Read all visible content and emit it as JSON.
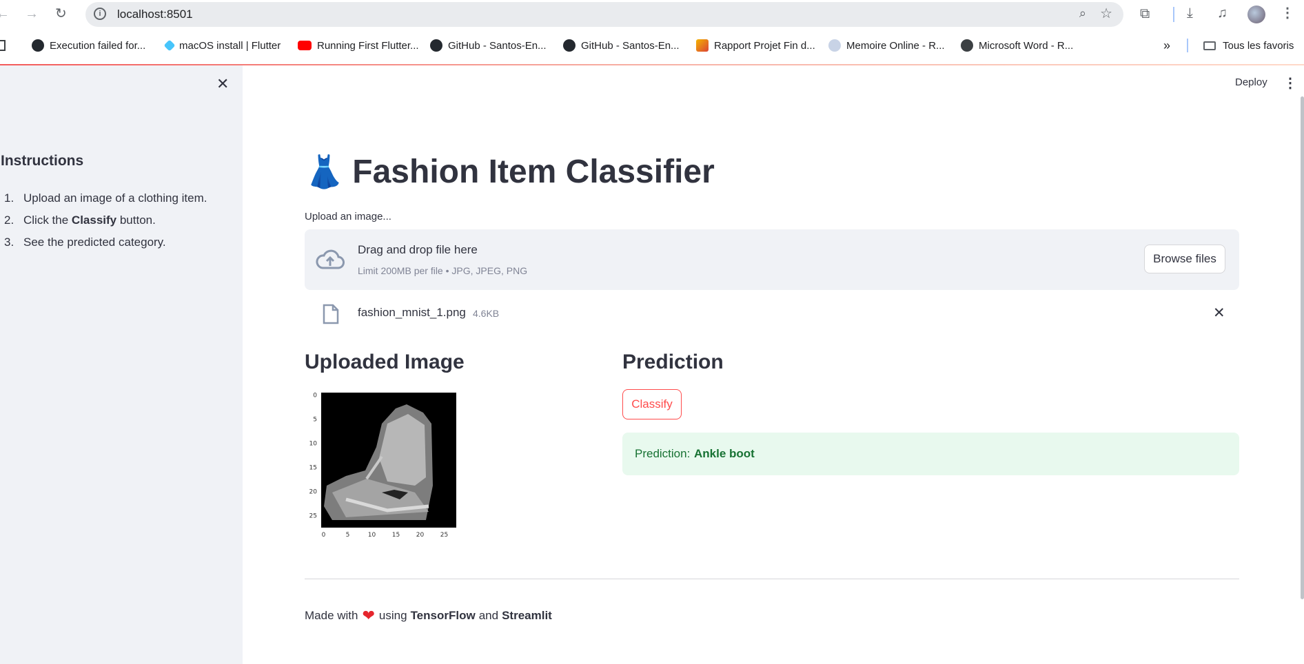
{
  "browser": {
    "url": "localhost:8501",
    "bookmarks": [
      {
        "label": "Execution failed for...",
        "icon": "github-icon"
      },
      {
        "label": "macOS install | Flutter",
        "icon": "flutter-icon"
      },
      {
        "label": "Running First Flutter...",
        "icon": "youtube-icon"
      },
      {
        "label": "GitHub - Santos-En...",
        "icon": "github-icon"
      },
      {
        "label": "GitHub - Santos-En...",
        "icon": "github-icon"
      },
      {
        "label": "Rapport Projet Fin d...",
        "icon": "doc-icon"
      },
      {
        "label": "Memoire Online - R...",
        "icon": "globe-icon"
      },
      {
        "label": "Microsoft Word - R...",
        "icon": "globe-icon"
      }
    ],
    "overflow_label": "»",
    "all_bookmarks": "Tous les favoris"
  },
  "app": {
    "deploy_label": "Deploy",
    "sidebar": {
      "title": "Instructions",
      "steps": [
        {
          "num": "1.",
          "text": "Upload an image of a clothing item."
        },
        {
          "num": "2.",
          "pre": "Click the ",
          "bold": "Classify",
          "post": " button."
        },
        {
          "num": "3.",
          "text": "See the predicted category."
        }
      ]
    },
    "title_emoji": "👗",
    "title": "Fashion Item Classifier",
    "uploader": {
      "label": "Upload an image...",
      "drag_text": "Drag and drop file here",
      "limit_text": "Limit 200MB per file • JPG, JPEG, PNG",
      "browse_label": "Browse files",
      "file_name": "fashion_mnist_1.png",
      "file_size": "4.6KB"
    },
    "uploaded_heading": "Uploaded Image",
    "image_axis": {
      "y_ticks": [
        "0",
        "5",
        "10",
        "15",
        "20",
        "25"
      ],
      "x_ticks": [
        "0",
        "5",
        "10",
        "15",
        "20",
        "25"
      ]
    },
    "prediction_heading": "Prediction",
    "classify_label": "Classify",
    "prediction": {
      "prefix": "Prediction: ",
      "value": "Ankle boot"
    },
    "footer": {
      "made_with": "Made with",
      "using": "using",
      "tf": "TensorFlow",
      "and": "and",
      "st": "Streamlit"
    },
    "colors": {
      "accent": "#ff4b4b",
      "success_bg": "#e8f9ee",
      "success_text": "#177233",
      "sidebar_bg": "#f0f2f6"
    }
  }
}
